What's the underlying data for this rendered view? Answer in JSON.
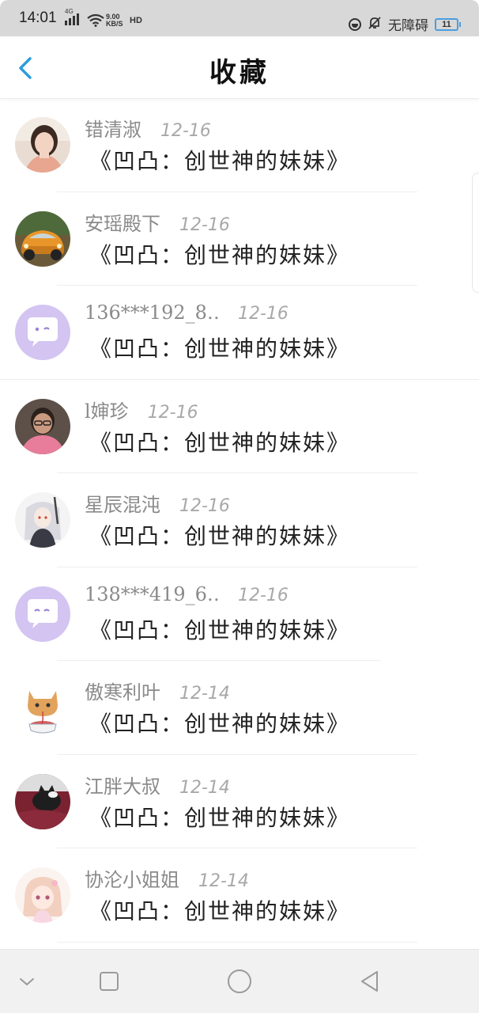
{
  "status_bar": {
    "time": "14:01",
    "network_label": "4G",
    "speed_value": "9.00",
    "speed_unit": "KB/S",
    "hd_label": "HD",
    "accessibility_label": "无障碍",
    "battery_level": "11",
    "icons": [
      "signal-icon",
      "wifi-icon",
      "circle-status-icon",
      "mute-bell-icon",
      "battery-icon"
    ]
  },
  "header": {
    "title": "收藏",
    "back_icon": "chevron-left-icon",
    "accent_color": "#2d9cdb"
  },
  "favorites": [
    {
      "name": "错清淑",
      "date": "12-16",
      "book": "《凹凸：创世神的妹妹》",
      "avatar": "photo-woman"
    },
    {
      "name": "安瑶殿下",
      "date": "12-16",
      "book": "《凹凸：创世神的妹妹》",
      "avatar": "orange-car"
    },
    {
      "name": "136***192_8…",
      "date": "12-16",
      "book": "《凹凸：创世神的妹妹》",
      "avatar": "default-chat"
    },
    {
      "name": "l婶珍",
      "date": "12-16",
      "book": "《凹凸：创世神的妹妹》",
      "avatar": "photo-person-glasses"
    },
    {
      "name": "星辰混沌",
      "date": "12-16",
      "book": "《凹凸：创世神的妹妹》",
      "avatar": "anime-character"
    },
    {
      "name": "138***419_6…",
      "date": "12-16",
      "book": "《凹凸：创世神的妹妹》",
      "avatar": "default-chat"
    },
    {
      "name": "傲寒利叶",
      "date": "12-14",
      "book": "《凹凸：创世神的妹妹》",
      "avatar": "cat-teacup"
    },
    {
      "name": "江胖大叔",
      "date": "12-14",
      "book": "《凹凸：创世神的妹妹》",
      "avatar": "cat-photo"
    },
    {
      "name": "协沦小姐姐",
      "date": "12-14",
      "book": "《凹凸：创世神的妹妹》",
      "avatar": "anime-girl"
    }
  ],
  "nav_bar": {
    "icons": [
      "collapse-down-icon",
      "recents-square-icon",
      "home-circle-icon",
      "back-triangle-icon"
    ]
  }
}
